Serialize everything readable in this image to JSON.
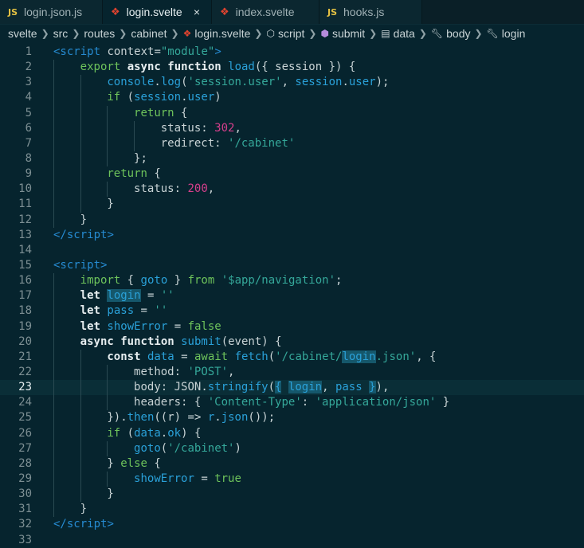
{
  "tabs": [
    {
      "label": "login.json.js",
      "icon": "js-icon",
      "icon_text": "JS",
      "active": false
    },
    {
      "label": "login.svelte",
      "icon": "svelte-icon",
      "icon_text": "",
      "active": true,
      "close": "×"
    },
    {
      "label": "index.svelte",
      "icon": "svelte-icon",
      "icon_text": "",
      "active": false
    },
    {
      "label": "hooks.js",
      "icon": "js-icon",
      "icon_text": "JS",
      "active": false
    }
  ],
  "breadcrumb": [
    {
      "label": "svelte",
      "icon": ""
    },
    {
      "label": "src",
      "icon": ""
    },
    {
      "label": "routes",
      "icon": ""
    },
    {
      "label": "cabinet",
      "icon": ""
    },
    {
      "label": "login.svelte",
      "icon": "svelte-icon"
    },
    {
      "label": "script",
      "icon": "symbol-icon"
    },
    {
      "label": "submit",
      "icon": "cube-icon"
    },
    {
      "label": "data",
      "icon": "field-icon"
    },
    {
      "label": "body",
      "icon": "wrench-icon"
    },
    {
      "label": "login",
      "icon": "wrench-icon"
    }
  ],
  "editor": {
    "current_line": 23,
    "lines": [
      {
        "n": "1",
        "indent": 0,
        "t": [
          [
            "tag",
            "<script"
          ],
          [
            "plain",
            " context="
          ],
          [
            "str",
            "\"module\""
          ],
          [
            "tag",
            ">"
          ]
        ]
      },
      {
        "n": "2",
        "indent": 1,
        "t": [
          [
            "kw",
            "export"
          ],
          [
            "plain",
            " "
          ],
          [
            "bold",
            "async function"
          ],
          [
            "plain",
            " "
          ],
          [
            "fn",
            "load"
          ],
          [
            "plain",
            "({ session }) {"
          ]
        ]
      },
      {
        "n": "3",
        "indent": 2,
        "t": [
          [
            "fn",
            "console"
          ],
          [
            "plain",
            "."
          ],
          [
            "fn",
            "log"
          ],
          [
            "plain",
            "("
          ],
          [
            "str",
            "'session.user'"
          ],
          [
            "plain",
            ", "
          ],
          [
            "fn",
            "session"
          ],
          [
            "plain",
            "."
          ],
          [
            "fn",
            "user"
          ],
          [
            "plain",
            ");"
          ]
        ]
      },
      {
        "n": "4",
        "indent": 2,
        "t": [
          [
            "kw",
            "if"
          ],
          [
            "plain",
            " ("
          ],
          [
            "fn",
            "session"
          ],
          [
            "plain",
            "."
          ],
          [
            "fn",
            "user"
          ],
          [
            "plain",
            ")"
          ]
        ]
      },
      {
        "n": "5",
        "indent": 3,
        "t": [
          [
            "kw",
            "return"
          ],
          [
            "plain",
            " {"
          ]
        ]
      },
      {
        "n": "6",
        "indent": 4,
        "t": [
          [
            "plain",
            "status: "
          ],
          [
            "num",
            "302"
          ],
          [
            "plain",
            ","
          ]
        ]
      },
      {
        "n": "7",
        "indent": 4,
        "t": [
          [
            "plain",
            "redirect: "
          ],
          [
            "str",
            "'/cabinet'"
          ]
        ]
      },
      {
        "n": "8",
        "indent": 3,
        "t": [
          [
            "plain",
            "};"
          ]
        ]
      },
      {
        "n": "9",
        "indent": 2,
        "t": [
          [
            "kw",
            "return"
          ],
          [
            "plain",
            " {"
          ]
        ]
      },
      {
        "n": "10",
        "indent": 3,
        "t": [
          [
            "plain",
            "status: "
          ],
          [
            "num",
            "200"
          ],
          [
            "plain",
            ","
          ]
        ]
      },
      {
        "n": "11",
        "indent": 2,
        "t": [
          [
            "plain",
            "}"
          ]
        ]
      },
      {
        "n": "12",
        "indent": 1,
        "t": [
          [
            "plain",
            "}"
          ]
        ]
      },
      {
        "n": "13",
        "indent": 0,
        "t": [
          [
            "tag",
            "</script"
          ],
          [
            "tag",
            ">"
          ]
        ]
      },
      {
        "n": "14",
        "indent": 0,
        "t": []
      },
      {
        "n": "15",
        "indent": 0,
        "t": [
          [
            "tag",
            "<script"
          ],
          [
            "tag",
            ">"
          ]
        ]
      },
      {
        "n": "16",
        "indent": 1,
        "t": [
          [
            "kw",
            "import"
          ],
          [
            "plain",
            " { "
          ],
          [
            "fn",
            "goto"
          ],
          [
            "plain",
            " } "
          ],
          [
            "kw",
            "from"
          ],
          [
            "plain",
            " "
          ],
          [
            "str",
            "'$app/navigation'"
          ],
          [
            "plain",
            ";"
          ]
        ]
      },
      {
        "n": "17",
        "indent": 1,
        "t": [
          [
            "bold",
            "let"
          ],
          [
            "plain",
            " "
          ],
          [
            "hl",
            "login"
          ],
          [
            "plain",
            " = "
          ],
          [
            "str",
            "''"
          ]
        ]
      },
      {
        "n": "18",
        "indent": 1,
        "t": [
          [
            "bold",
            "let"
          ],
          [
            "plain",
            " "
          ],
          [
            "fn",
            "pass"
          ],
          [
            "plain",
            " = "
          ],
          [
            "str",
            "''"
          ]
        ]
      },
      {
        "n": "19",
        "indent": 1,
        "t": [
          [
            "bold",
            "let"
          ],
          [
            "plain",
            " "
          ],
          [
            "fn",
            "showError"
          ],
          [
            "plain",
            " = "
          ],
          [
            "kw",
            "false"
          ]
        ]
      },
      {
        "n": "20",
        "indent": 1,
        "t": [
          [
            "bold",
            "async function"
          ],
          [
            "plain",
            " "
          ],
          [
            "fn",
            "submit"
          ],
          [
            "plain",
            "(event) {"
          ]
        ]
      },
      {
        "n": "21",
        "indent": 2,
        "t": [
          [
            "bold",
            "const"
          ],
          [
            "plain",
            " "
          ],
          [
            "fn",
            "data"
          ],
          [
            "plain",
            " = "
          ],
          [
            "kw",
            "await"
          ],
          [
            "plain",
            " "
          ],
          [
            "fn",
            "fetch"
          ],
          [
            "plain",
            "("
          ],
          [
            "str",
            "'/cabinet/"
          ],
          [
            "hl",
            "login"
          ],
          [
            "str",
            ".json'"
          ],
          [
            "plain",
            ", {"
          ]
        ]
      },
      {
        "n": "22",
        "indent": 3,
        "t": [
          [
            "plain",
            "method: "
          ],
          [
            "str",
            "'POST'"
          ],
          [
            "plain",
            ","
          ]
        ]
      },
      {
        "n": "23",
        "indent": 3,
        "t": [
          [
            "plain",
            "body: JSON."
          ],
          [
            "fn",
            "stringify"
          ],
          [
            "plain",
            "("
          ],
          [
            "hl",
            "{"
          ],
          [
            "plain",
            " "
          ],
          [
            "hl",
            "login"
          ],
          [
            "plain",
            ", "
          ],
          [
            "fn",
            "pass"
          ],
          [
            "plain",
            " "
          ],
          [
            "hl",
            "}"
          ],
          [
            "plain",
            "),"
          ]
        ]
      },
      {
        "n": "24",
        "indent": 3,
        "t": [
          [
            "plain",
            "headers: { "
          ],
          [
            "str",
            "'Content-Type'"
          ],
          [
            "plain",
            ": "
          ],
          [
            "str",
            "'application/json'"
          ],
          [
            "plain",
            " }"
          ]
        ]
      },
      {
        "n": "25",
        "indent": 2,
        "t": [
          [
            "plain",
            "})."
          ],
          [
            "fn",
            "then"
          ],
          [
            "plain",
            "((r) => "
          ],
          [
            "fn",
            "r"
          ],
          [
            "plain",
            "."
          ],
          [
            "fn",
            "json"
          ],
          [
            "plain",
            "());"
          ]
        ]
      },
      {
        "n": "26",
        "indent": 2,
        "t": [
          [
            "kw",
            "if"
          ],
          [
            "plain",
            " ("
          ],
          [
            "fn",
            "data"
          ],
          [
            "plain",
            "."
          ],
          [
            "fn",
            "ok"
          ],
          [
            "plain",
            ") {"
          ]
        ]
      },
      {
        "n": "27",
        "indent": 3,
        "t": [
          [
            "fn",
            "goto"
          ],
          [
            "plain",
            "("
          ],
          [
            "str",
            "'/cabinet'"
          ],
          [
            "plain",
            ")"
          ]
        ]
      },
      {
        "n": "28",
        "indent": 2,
        "t": [
          [
            "plain",
            "} "
          ],
          [
            "kw",
            "else"
          ],
          [
            "plain",
            " {"
          ]
        ]
      },
      {
        "n": "29",
        "indent": 3,
        "t": [
          [
            "fn",
            "showError"
          ],
          [
            "plain",
            " = "
          ],
          [
            "kw",
            "true"
          ]
        ]
      },
      {
        "n": "30",
        "indent": 2,
        "t": [
          [
            "plain",
            "}"
          ]
        ]
      },
      {
        "n": "31",
        "indent": 1,
        "t": [
          [
            "plain",
            "}"
          ]
        ]
      },
      {
        "n": "32",
        "indent": 0,
        "t": [
          [
            "tag",
            "</script"
          ],
          [
            "tag",
            ">"
          ]
        ]
      },
      {
        "n": "33",
        "indent": 0,
        "t": []
      }
    ]
  }
}
